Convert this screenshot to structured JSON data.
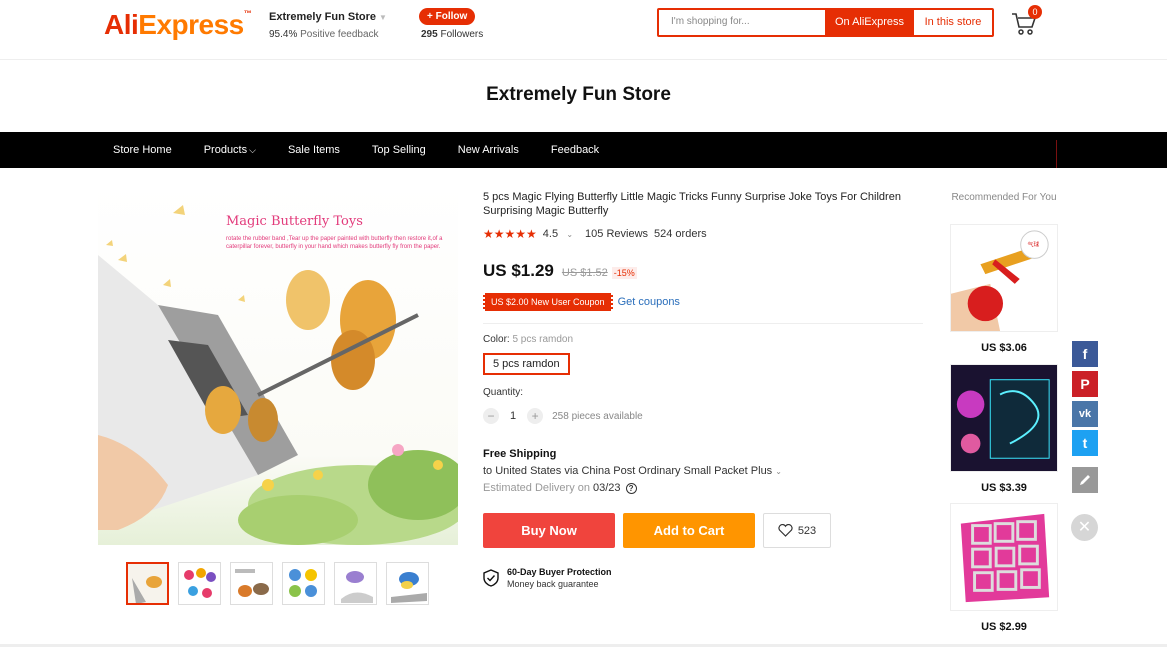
{
  "header": {
    "logo_text_1": "Ali",
    "logo_text_2": "Express",
    "logo_tm": "™",
    "store_name": "Extremely Fun Store",
    "positive_feedback_pct": "95.4%",
    "positive_feedback_label": "Positive feedback",
    "follow_label": "+ Follow",
    "followers_count": "295",
    "followers_label": "Followers",
    "search_placeholder": "I'm shopping for...",
    "search_on_aliexpress": "On AliExpress",
    "search_in_store": "In this store",
    "cart_count": "0"
  },
  "banner": {
    "title": "Extremely Fun Store"
  },
  "nav": {
    "items": [
      "Store Home",
      "Products",
      "Sale Items",
      "Top Selling",
      "New Arrivals",
      "Feedback"
    ]
  },
  "main_image": {
    "headline": "Magic Butterfly Toys",
    "caption": "rotate the rubber band ,Tear up the paper painted with butterfly then restore it,of a caterpillar forever, butterfly in your hand which makes butterfly fly from the paper."
  },
  "product": {
    "title": "5 pcs Magic Flying Butterfly Little Magic Tricks Funny Surprise Joke Toys For Children Surprising Magic Butterfly",
    "rating": "4.5",
    "reviews": "105 Reviews",
    "orders": "524 orders",
    "price": "US $1.29",
    "old_price": "US $1.52",
    "discount": "-15%",
    "coupon": "US $2.00 New User Coupon",
    "get_coupons": "Get coupons",
    "color_label": "Color:",
    "color_selected": "5 pcs ramdon",
    "color_option": "5 pcs ramdon",
    "quantity_label": "Quantity:",
    "quantity": "1",
    "available": "258 pieces available",
    "shipping_title": "Free Shipping",
    "shipping_via": "to United States via China Post Ordinary Small Packet Plus",
    "delivery_label": "Estimated Delivery on",
    "delivery_date": "03/23",
    "buy_now": "Buy Now",
    "add_to_cart": "Add to Cart",
    "wishlist_count": "523",
    "protection_title": "60-Day Buyer Protection",
    "protection_sub": "Money back guarantee"
  },
  "recommended": {
    "title": "Recommended For You",
    "items": [
      {
        "price": "US $3.06"
      },
      {
        "price": "US $3.39"
      },
      {
        "price": "US $2.99"
      }
    ]
  },
  "social": {
    "facebook": "f",
    "pinterest": "P",
    "vk": "vk",
    "twitter": "t"
  },
  "colors": {
    "brand_red": "#e62e04",
    "orange": "#ff9500",
    "link_blue": "#2a6ebb"
  }
}
